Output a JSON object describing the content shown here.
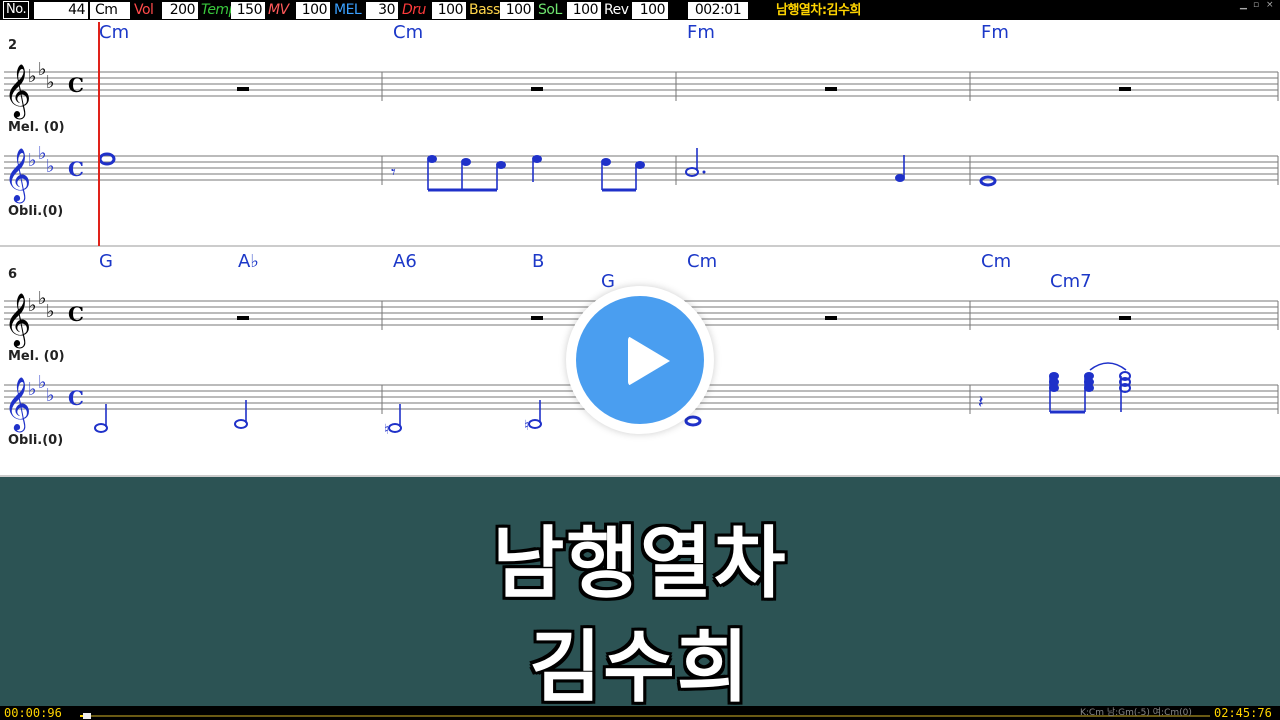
{
  "topbar": {
    "no_label": "No.",
    "no_value": "44",
    "key": "Cm",
    "vol_label": "Vol",
    "vol_value": "200",
    "temp_label": "Temp",
    "temp_value": "150",
    "mv_label": "MV",
    "mv_value": "100",
    "mel_label": "MEL",
    "mel_value": "30",
    "dru_label": "Dru",
    "dru_value": "100",
    "bass_label": "Bass",
    "bass_value": "100",
    "sol_label": "SoL",
    "sol_value": "100",
    "rev_label": "Rev",
    "rev_value": "100",
    "clock": "002:01",
    "song_title": "남행열차:김수희",
    "colors": {
      "vol": "#ff4a4a",
      "temp": "#39c63c",
      "mv": "#ff5a5a",
      "mel": "#3aa0ff",
      "dru": "#ff3b3b",
      "bass": "#ffd54a",
      "sol": "#6ee36e",
      "rev": "#ffffff"
    }
  },
  "score": {
    "system1": {
      "measure_number": "2",
      "chords": [
        "Cm",
        "Cm",
        "Fm",
        "Fm"
      ],
      "track1": "Mel. (0)",
      "track2": "Obli.(0)"
    },
    "system2": {
      "measure_number": "6",
      "chords": [
        "G",
        "A♭",
        "A6",
        "B",
        "G",
        "Cm",
        "Cm",
        "Cm7"
      ],
      "track1": "Mel. (0)",
      "track2": "Obli.(0)"
    },
    "time_signature": "C",
    "note_color": "#1f31c9"
  },
  "lyrics": {
    "line1": "남행열차",
    "line2": "김수희"
  },
  "bottombar": {
    "elapsed": "00:00:96",
    "total": "02:45:76",
    "key_info": "K:Cm 남:Gm(-5) 여:Cm(0)",
    "progress": 0.006
  },
  "play_icon": "play-icon"
}
